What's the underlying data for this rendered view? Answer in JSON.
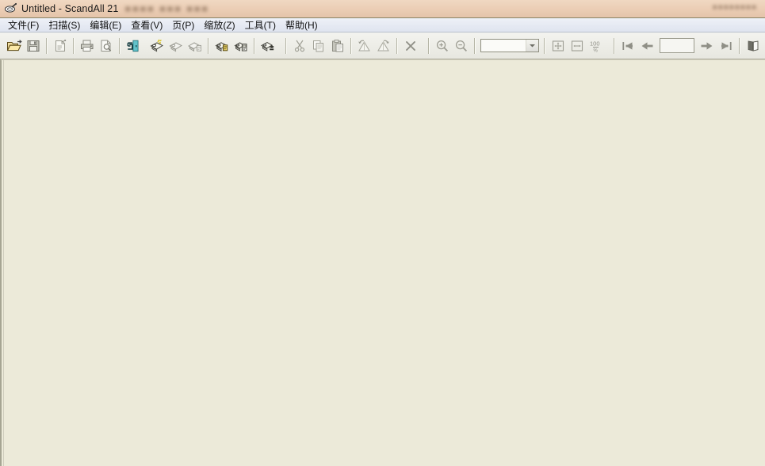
{
  "window": {
    "title": "Untitled - ScandAll 21",
    "app_icon": "scanner-pen-icon",
    "title_overlay_blur": "■■■■ ■■■ ■■■",
    "title_overlay_right": "■■■■■■■■",
    "client_background": "#ecead9",
    "titlebar_color": "#ebcdb4",
    "menubar_color": "#e6eaf3",
    "toolbar_color": "#eeeee8"
  },
  "menu": {
    "items": [
      {
        "label": "文件(F)",
        "name": "menu-file"
      },
      {
        "label": "扫描(S)",
        "name": "menu-scan"
      },
      {
        "label": "编辑(E)",
        "name": "menu-edit"
      },
      {
        "label": "查看(V)",
        "name": "menu-view"
      },
      {
        "label": "页(P)",
        "name": "menu-page"
      },
      {
        "label": "缩放(Z)",
        "name": "menu-zoom"
      },
      {
        "label": "工具(T)",
        "name": "menu-tools"
      },
      {
        "label": "帮助(H)",
        "name": "menu-help"
      }
    ]
  },
  "toolbar": {
    "zoom_combo": {
      "value": "",
      "placeholder": ""
    },
    "page_input": {
      "value": "",
      "placeholder": ""
    },
    "buttons": [
      {
        "name": "open-file-icon",
        "tooltip": "打开",
        "enabled": true
      },
      {
        "name": "save-icon",
        "tooltip": "保存",
        "enabled": false
      },
      {
        "name": "document-properties-icon",
        "tooltip": "属性",
        "enabled": false
      },
      {
        "name": "print-icon",
        "tooltip": "打印",
        "enabled": false
      },
      {
        "name": "print-preview-icon",
        "tooltip": "打印预览",
        "enabled": false
      },
      {
        "name": "exit-icon",
        "tooltip": "退出",
        "enabled": true
      },
      {
        "name": "scan-icon",
        "tooltip": "扫描",
        "enabled": true
      },
      {
        "name": "scan-batch-icon",
        "tooltip": "批量扫描",
        "enabled": false
      },
      {
        "name": "scan-to-file-icon",
        "tooltip": "扫描到文件",
        "enabled": false
      },
      {
        "name": "scanner-settings-icon",
        "tooltip": "扫描仪设置",
        "enabled": true
      },
      {
        "name": "scanner-select-icon",
        "tooltip": "选择扫描仪",
        "enabled": true
      },
      {
        "name": "scan-options-icon",
        "tooltip": "扫描选项",
        "enabled": true
      },
      {
        "name": "cut-icon",
        "tooltip": "剪切",
        "enabled": false
      },
      {
        "name": "copy-icon",
        "tooltip": "复制",
        "enabled": false
      },
      {
        "name": "paste-icon",
        "tooltip": "粘贴",
        "enabled": false
      },
      {
        "name": "rotate-left-icon",
        "tooltip": "向左旋转",
        "enabled": false
      },
      {
        "name": "rotate-right-icon",
        "tooltip": "向右旋转",
        "enabled": false
      },
      {
        "name": "delete-icon",
        "tooltip": "删除",
        "enabled": false
      },
      {
        "name": "zoom-in-icon",
        "tooltip": "放大",
        "enabled": false
      },
      {
        "name": "zoom-out-icon",
        "tooltip": "缩小",
        "enabled": false
      },
      {
        "name": "fit-page-icon",
        "tooltip": "适合页面",
        "enabled": false
      },
      {
        "name": "fit-width-icon",
        "tooltip": "适合宽度",
        "enabled": false
      },
      {
        "name": "zoom-100-icon",
        "tooltip": "100%",
        "enabled": false,
        "label": "100"
      },
      {
        "name": "first-page-icon",
        "tooltip": "第一页",
        "enabled": false
      },
      {
        "name": "prev-page-icon",
        "tooltip": "上一页",
        "enabled": false
      },
      {
        "name": "next-page-icon",
        "tooltip": "下一页",
        "enabled": false
      },
      {
        "name": "last-page-icon",
        "tooltip": "最后一页",
        "enabled": false
      },
      {
        "name": "two-page-view-icon",
        "tooltip": "双页显示",
        "enabled": false
      }
    ],
    "zoom_100_label": "100"
  },
  "client": {
    "content": ""
  }
}
